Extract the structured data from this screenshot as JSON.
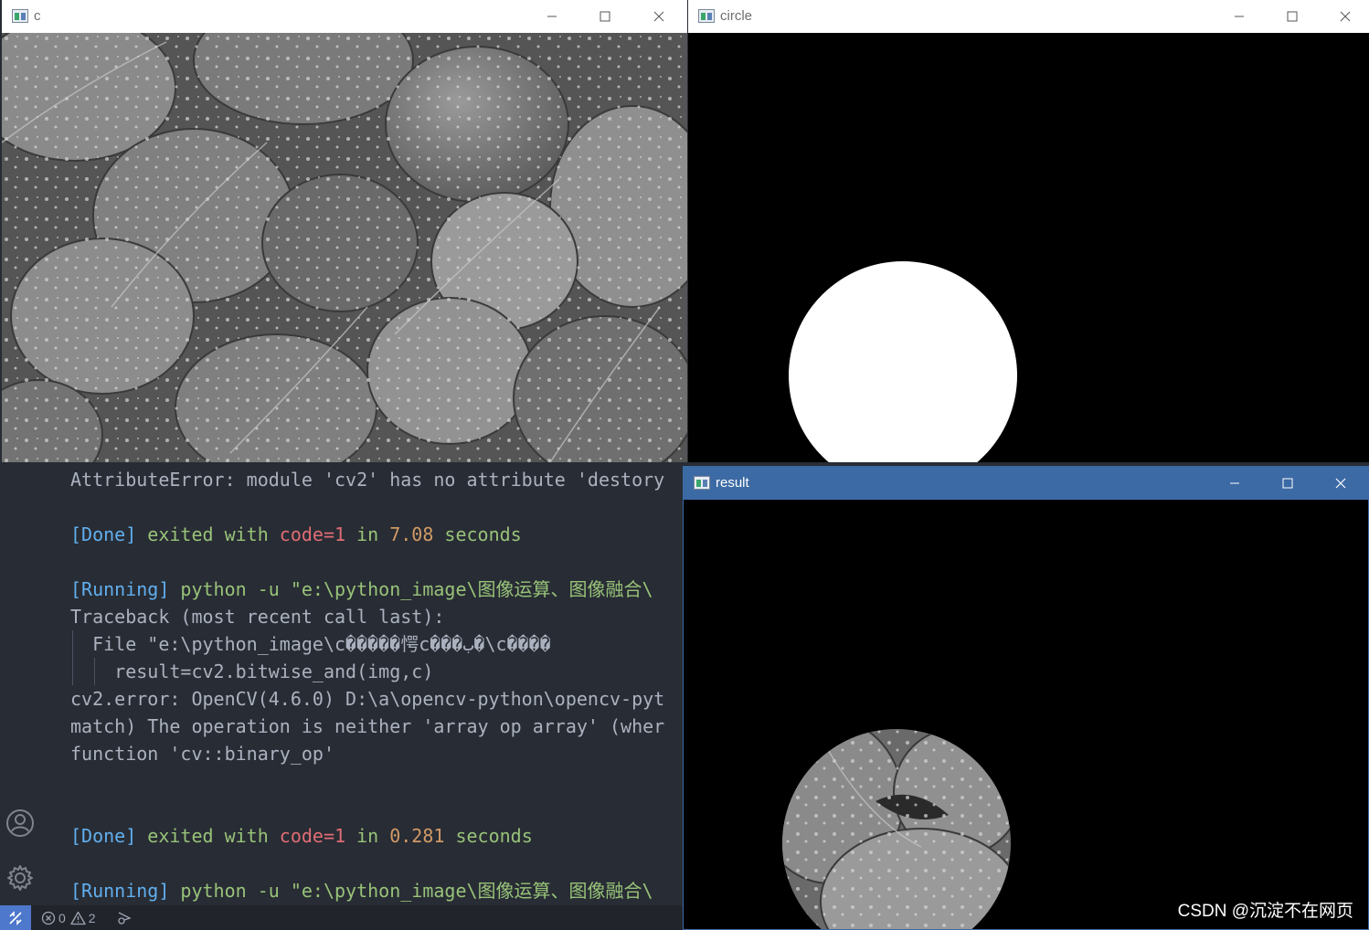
{
  "terminal": {
    "lines": [
      {
        "parts": [
          {
            "t": "AttributeError: module 'cv2' has no attribute 'destory",
            "c": ""
          }
        ]
      },
      {
        "parts": [
          {
            "t": "[Done]",
            "c": "blue"
          },
          {
            "t": " exited with ",
            "c": "green"
          },
          {
            "t": "code=1",
            "c": "red"
          },
          {
            "t": " in ",
            "c": "green"
          },
          {
            "t": "7.08",
            "c": "orange"
          },
          {
            "t": " seconds",
            "c": "green"
          }
        ]
      },
      {
        "parts": [
          {
            "t": "[Running]",
            "c": "blue"
          },
          {
            "t": " python -u \"e:\\python_image\\图像运算、图像融合\\",
            "c": "green"
          }
        ]
      },
      {
        "parts": [
          {
            "t": "Traceback (most recent call last):",
            "c": ""
          }
        ]
      },
      {
        "parts": [
          {
            "t": "  File \"e:\\python_image\\c�����愕c���ب�\\c����",
            "c": ""
          }
        ]
      },
      {
        "parts": [
          {
            "t": "    result=cv2.bitwise_and(img,c)",
            "c": ""
          }
        ]
      },
      {
        "parts": [
          {
            "t": "cv2.error: OpenCV(4.6.0) D:\\a\\opencv-python\\opencv-pyt",
            "c": ""
          }
        ]
      },
      {
        "parts": [
          {
            "t": "match) The operation is neither 'array op array' (wher",
            "c": ""
          }
        ]
      },
      {
        "parts": [
          {
            "t": "function 'cv::binary_op'",
            "c": ""
          }
        ]
      },
      {
        "parts": [
          {
            "t": "[Done]",
            "c": "blue"
          },
          {
            "t": " exited with ",
            "c": "green"
          },
          {
            "t": "code=1",
            "c": "red"
          },
          {
            "t": " in ",
            "c": "green"
          },
          {
            "t": "0.281",
            "c": "orange"
          },
          {
            "t": " seconds",
            "c": "green"
          }
        ]
      },
      {
        "parts": [
          {
            "t": "[Running]",
            "c": "blue"
          },
          {
            "t": " python -u \"e:\\python_image\\图像运算、图像融合\\",
            "c": "green"
          }
        ]
      }
    ]
  },
  "status_bar": {
    "errors": "0",
    "warnings": "2"
  },
  "windows": {
    "c": {
      "title": "c"
    },
    "circle": {
      "title": "circle"
    },
    "result": {
      "title": "result"
    }
  },
  "watermark": "CSDN @沉淀不在网页",
  "icons": {
    "account": "account-icon",
    "settings": "gear-icon",
    "remote": "remote-icon",
    "error": "error-icon",
    "warning": "warning-icon",
    "broadcast": "broadcast-icon",
    "minimize": "minimize-icon",
    "maximize": "maximize-icon",
    "close": "close-icon"
  },
  "colors": {
    "editor_bg": "#282c34",
    "blue": "#61afef",
    "green": "#98c379",
    "red": "#e06c75",
    "orange": "#d19a66",
    "result_titlebar": "#3c6aa5"
  }
}
